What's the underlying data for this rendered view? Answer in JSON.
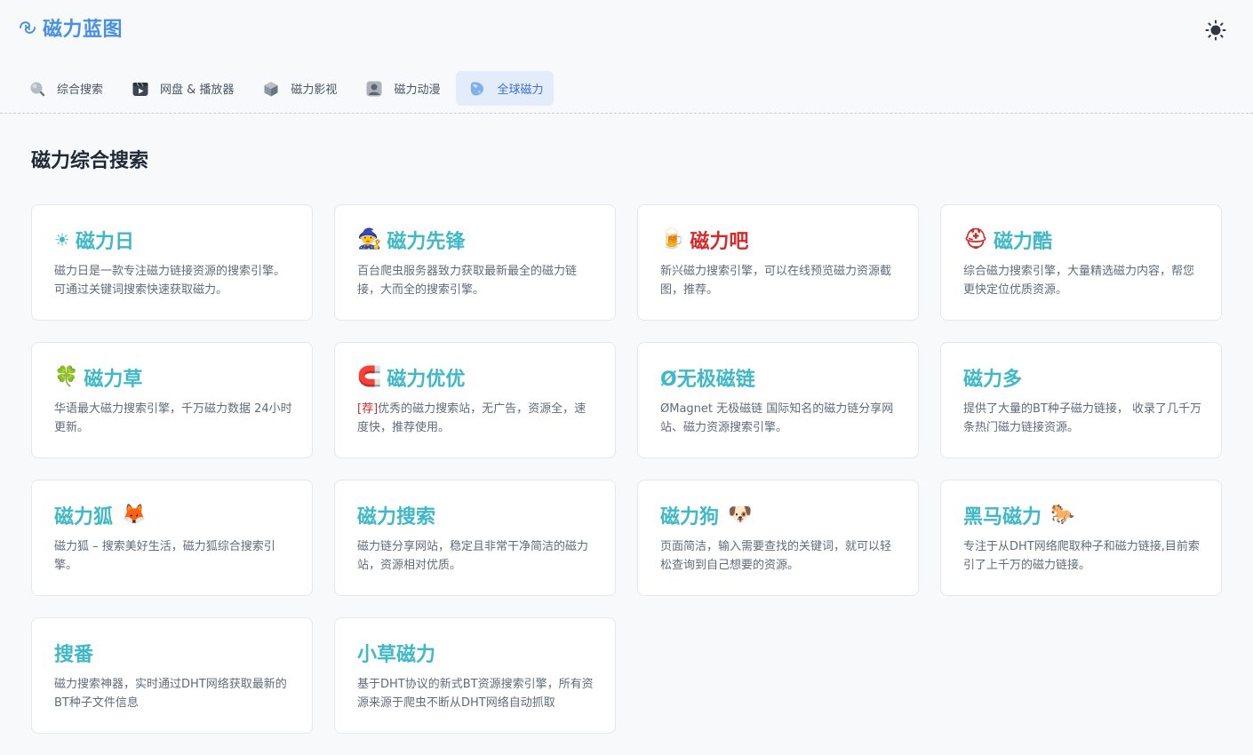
{
  "header": {
    "logo_text": "磁力蓝图",
    "theme_toggle": "sun-icon"
  },
  "nav": {
    "tabs": [
      {
        "label": "综合搜索",
        "icon": "search-icon",
        "active": false
      },
      {
        "label": "网盘 & 播放器",
        "icon": "video-icon",
        "active": false
      },
      {
        "label": "磁力影视",
        "icon": "cube-icon",
        "active": false
      },
      {
        "label": "磁力动漫",
        "icon": "person-icon",
        "active": false
      },
      {
        "label": "全球磁力",
        "icon": "globe-icon",
        "active": true
      }
    ]
  },
  "section": {
    "title": "磁力综合搜索"
  },
  "cards": [
    {
      "emoji_before": "☀",
      "title": "磁力日",
      "emoji_after": "",
      "tag": "",
      "desc": "磁力日是一款专注磁力链接资源的搜索引擎。可通过关键词搜索快速获取磁力。",
      "red": false
    },
    {
      "emoji_before": "🧙",
      "title": "磁力先锋",
      "emoji_after": "",
      "tag": "",
      "desc": "百台爬虫服务器致力获取最新最全的磁力链接，大而全的搜索引擎。",
      "red": false
    },
    {
      "emoji_before": "🍺",
      "title": "磁力吧",
      "emoji_after": "",
      "tag": "",
      "desc": "新兴磁力搜索引擎，可以在线预览磁力资源截图，推荐。",
      "red": true
    },
    {
      "emoji_before": "⛑",
      "title": "磁力酷",
      "emoji_after": "",
      "tag": "",
      "desc": "综合磁力搜索引擎，大量精选磁力内容，帮您更快定位优质资源。",
      "red": false
    },
    {
      "emoji_before": "🍀",
      "title": "磁力草",
      "emoji_after": "",
      "tag": "",
      "desc": "华语最大磁力搜索引擎，千万磁力数据 24小时更新。",
      "red": false
    },
    {
      "emoji_before": "🧲",
      "title": "磁力优优",
      "emoji_after": "",
      "tag": "[荐]",
      "desc": "优秀的磁力搜索站，无广告，资源全，速度快，推荐使用。",
      "red": false
    },
    {
      "emoji_before": "",
      "title": "Ø无极磁链",
      "emoji_after": "",
      "tag": "",
      "desc": "ØMagnet 无极磁链 国际知名的磁力链分享网站、磁力资源搜索引擎。",
      "red": false
    },
    {
      "emoji_before": "",
      "title": "磁力多",
      "emoji_after": "",
      "tag": "",
      "desc": "提供了大量的BT种子磁力链接， 收录了几千万条热门磁力链接资源。",
      "red": false
    },
    {
      "emoji_before": "",
      "title": "磁力狐",
      "emoji_after": "🦊",
      "tag": "",
      "desc": "磁力狐 – 搜索美好生活，磁力狐综合搜索引擎。",
      "red": false
    },
    {
      "emoji_before": "",
      "title": "磁力搜索",
      "emoji_after": "",
      "tag": "",
      "desc": "磁力链分享网站，稳定且非常干净简洁的磁力站，资源相对优质。",
      "red": false
    },
    {
      "emoji_before": "",
      "title": "磁力狗",
      "emoji_after": "🐶",
      "tag": "",
      "desc": "页面简洁，输入需要查找的关键词，就可以轻松查询到自己想要的资源。",
      "red": false
    },
    {
      "emoji_before": "",
      "title": "黑马磁力",
      "emoji_after": "🐎",
      "tag": "",
      "desc": "专注于从DHT网络爬取种子和磁力链接,目前索引了上千万的磁力链接。",
      "red": false
    },
    {
      "emoji_before": "",
      "title": "搜番",
      "emoji_after": "",
      "tag": "",
      "desc": "磁力搜索神器，实时通过DHT网络获取最新的BT种子文件信息",
      "red": false
    },
    {
      "emoji_before": "",
      "title": "小草磁力",
      "emoji_after": "",
      "tag": "",
      "desc": "基于DHT协议的新式BT资源搜索引擎，所有资源来源于爬虫不断从DHT网络自动抓取",
      "red": false
    }
  ]
}
